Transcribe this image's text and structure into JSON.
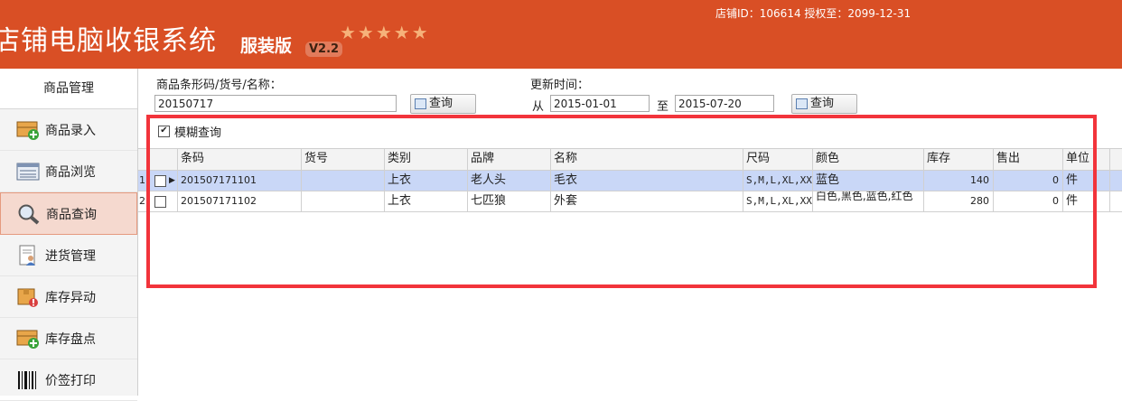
{
  "header": {
    "app_title": "店铺电脑收银系统",
    "edition": "服装版",
    "version": "V2.2",
    "stars": "★★★★★",
    "shop_info": "店铺ID：106614 授权至：2099-12-31"
  },
  "sidebar": {
    "heading": "商品管理",
    "items": [
      {
        "label": "商品录入",
        "icon": "box-add-icon"
      },
      {
        "label": "商品浏览",
        "icon": "list-icon"
      },
      {
        "label": "商品查询",
        "icon": "magnifier-icon"
      },
      {
        "label": "进货管理",
        "icon": "document-user-icon"
      },
      {
        "label": "库存异动",
        "icon": "box-alert-icon"
      },
      {
        "label": "库存盘点",
        "icon": "box-add-icon"
      },
      {
        "label": "价签打印",
        "icon": "barcode-icon"
      }
    ]
  },
  "search": {
    "code_label": "商品条形码/货号/名称：",
    "code_value": "20150717",
    "query_label": "查询",
    "update_label": "更新时间：",
    "from_label": "从",
    "from_value": "2015-01-01",
    "to_label": "至",
    "to_value": "2015-07-20",
    "query2_label": "查询",
    "fuzzy_label": "模糊查询",
    "fuzzy_checked": "✔"
  },
  "table": {
    "columns": [
      "条码",
      "货号",
      "类别",
      "品牌",
      "名称",
      "尺码",
      "颜色",
      "库存",
      "售出",
      "单位"
    ],
    "rows": [
      {
        "index": "1",
        "barcode": "201507171101",
        "sku": "",
        "category": "上衣",
        "brand": "老人头",
        "name": "毛衣",
        "size": "S,M,L,XL,XX",
        "color": "蓝色",
        "stock": "140",
        "sold": "0",
        "unit": "件"
      },
      {
        "index": "2",
        "barcode": "201507171102",
        "sku": "",
        "category": "上衣",
        "brand": "七匹狼",
        "name": "外套",
        "size": "S,M,L,XL,XX",
        "color": "白色,黑色,蓝色,红色",
        "stock": "280",
        "sold": "0",
        "unit": "件"
      }
    ]
  },
  "colors": {
    "header_bg": "#d94f25",
    "selected_row": "#c9d7f7",
    "highlight_box": "#f2343b"
  }
}
